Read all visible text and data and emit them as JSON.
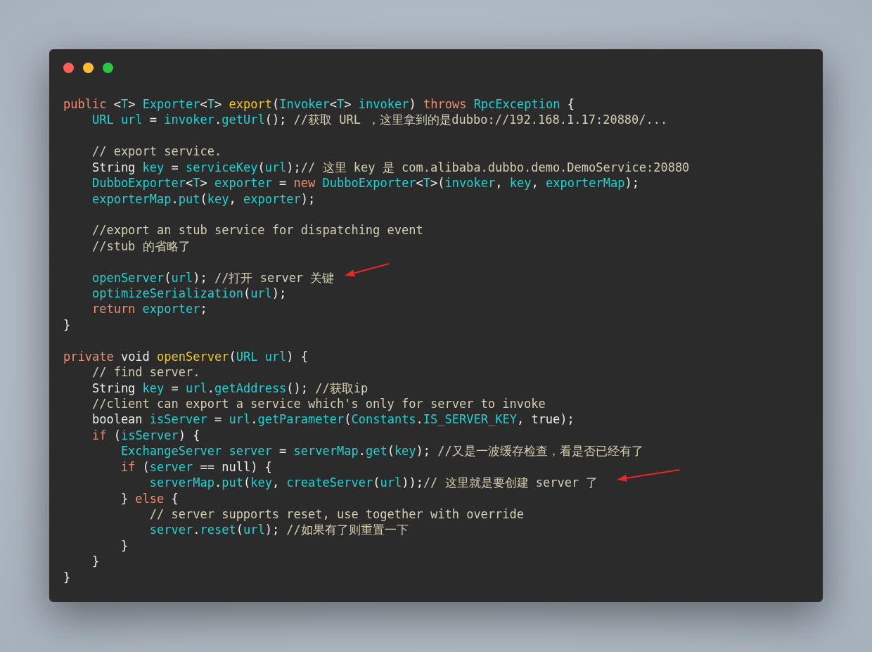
{
  "window": {
    "controls": [
      {
        "color": "#fe5f57"
      },
      {
        "color": "#febc2e"
      },
      {
        "color": "#28c840"
      }
    ]
  },
  "code_lines": [
    {
      "kind": "code",
      "tokens": [
        {
          "kind": "keyword",
          "text": "public "
        },
        {
          "kind": "plain",
          "text": "<"
        },
        {
          "kind": "ident",
          "text": "T"
        },
        {
          "kind": "plain",
          "text": "> "
        },
        {
          "kind": "ident",
          "text": "Exporter"
        },
        {
          "kind": "plain",
          "text": "<"
        },
        {
          "kind": "ident",
          "text": "T"
        },
        {
          "kind": "plain",
          "text": "> "
        },
        {
          "kind": "function",
          "text": "export"
        },
        {
          "kind": "plain",
          "text": "("
        },
        {
          "kind": "ident",
          "text": "Invoker"
        },
        {
          "kind": "plain",
          "text": "<"
        },
        {
          "kind": "ident",
          "text": "T"
        },
        {
          "kind": "plain",
          "text": "> "
        },
        {
          "kind": "ident",
          "text": "invoker"
        },
        {
          "kind": "plain",
          "text": ") "
        },
        {
          "kind": "keyword",
          "text": "throws "
        },
        {
          "kind": "ident",
          "text": "RpcException"
        },
        {
          "kind": "plain",
          "text": " {"
        }
      ]
    },
    {
      "kind": "code",
      "tokens": [
        {
          "kind": "ident",
          "text": "    URL url"
        },
        {
          "kind": "plain",
          "text": " = "
        },
        {
          "kind": "ident",
          "text": "invoker"
        },
        {
          "kind": "plain",
          "text": "."
        },
        {
          "kind": "ident",
          "text": "getUrl"
        },
        {
          "kind": "plain",
          "text": "(); "
        },
        {
          "kind": "comment",
          "text": "//获取 URL ，这里拿到的是dubbo://192.168.1.17:20880/..."
        }
      ]
    },
    {
      "kind": "blank"
    },
    {
      "kind": "code",
      "tokens": [
        {
          "kind": "comment",
          "text": "    // export service."
        }
      ]
    },
    {
      "kind": "code",
      "tokens": [
        {
          "kind": "plain",
          "text": "    String "
        },
        {
          "kind": "ident",
          "text": "key"
        },
        {
          "kind": "plain",
          "text": " = "
        },
        {
          "kind": "ident",
          "text": "serviceKey"
        },
        {
          "kind": "plain",
          "text": "("
        },
        {
          "kind": "ident",
          "text": "url"
        },
        {
          "kind": "plain",
          "text": ");"
        },
        {
          "kind": "comment",
          "text": "// 这里 key 是 com.alibaba.dubbo.demo.DemoService:20880"
        }
      ]
    },
    {
      "kind": "code",
      "tokens": [
        {
          "kind": "ident",
          "text": "    DubboExporter"
        },
        {
          "kind": "plain",
          "text": "<"
        },
        {
          "kind": "ident",
          "text": "T"
        },
        {
          "kind": "plain",
          "text": "> "
        },
        {
          "kind": "ident",
          "text": "exporter"
        },
        {
          "kind": "plain",
          "text": " = "
        },
        {
          "kind": "keyword",
          "text": "new "
        },
        {
          "kind": "ident",
          "text": "DubboExporter"
        },
        {
          "kind": "plain",
          "text": "<"
        },
        {
          "kind": "ident",
          "text": "T"
        },
        {
          "kind": "plain",
          "text": ">("
        },
        {
          "kind": "ident",
          "text": "invoker"
        },
        {
          "kind": "plain",
          "text": ", "
        },
        {
          "kind": "ident",
          "text": "key"
        },
        {
          "kind": "plain",
          "text": ", "
        },
        {
          "kind": "ident",
          "text": "exporterMap"
        },
        {
          "kind": "plain",
          "text": ");"
        }
      ]
    },
    {
      "kind": "code",
      "tokens": [
        {
          "kind": "ident",
          "text": "    exporterMap"
        },
        {
          "kind": "plain",
          "text": "."
        },
        {
          "kind": "ident",
          "text": "put"
        },
        {
          "kind": "plain",
          "text": "("
        },
        {
          "kind": "ident",
          "text": "key"
        },
        {
          "kind": "plain",
          "text": ", "
        },
        {
          "kind": "ident",
          "text": "exporter"
        },
        {
          "kind": "plain",
          "text": ");"
        }
      ]
    },
    {
      "kind": "blank"
    },
    {
      "kind": "code",
      "tokens": [
        {
          "kind": "comment",
          "text": "    //export an stub service for dispatching event"
        }
      ]
    },
    {
      "kind": "code",
      "tokens": [
        {
          "kind": "comment",
          "text": "    //stub 的省略了"
        }
      ]
    },
    {
      "kind": "blank"
    },
    {
      "kind": "code",
      "tokens": [
        {
          "kind": "ident",
          "text": "    openServer"
        },
        {
          "kind": "plain",
          "text": "("
        },
        {
          "kind": "ident",
          "text": "url"
        },
        {
          "kind": "plain",
          "text": "); "
        },
        {
          "kind": "comment",
          "text": "//打开 server 关键"
        }
      ]
    },
    {
      "kind": "code",
      "tokens": [
        {
          "kind": "ident",
          "text": "    optimizeSerialization"
        },
        {
          "kind": "plain",
          "text": "("
        },
        {
          "kind": "ident",
          "text": "url"
        },
        {
          "kind": "plain",
          "text": ");"
        }
      ]
    },
    {
      "kind": "code",
      "tokens": [
        {
          "kind": "keyword",
          "text": "    return "
        },
        {
          "kind": "ident",
          "text": "exporter"
        },
        {
          "kind": "plain",
          "text": ";"
        }
      ]
    },
    {
      "kind": "code",
      "tokens": [
        {
          "kind": "plain",
          "text": "}"
        }
      ]
    },
    {
      "kind": "blank"
    },
    {
      "kind": "code",
      "tokens": [
        {
          "kind": "keyword",
          "text": "private "
        },
        {
          "kind": "plain",
          "text": "void "
        },
        {
          "kind": "function",
          "text": "openServer"
        },
        {
          "kind": "plain",
          "text": "("
        },
        {
          "kind": "ident",
          "text": "URL url"
        },
        {
          "kind": "plain",
          "text": ") {"
        }
      ]
    },
    {
      "kind": "code",
      "tokens": [
        {
          "kind": "comment",
          "text": "    // find server."
        }
      ]
    },
    {
      "kind": "code",
      "tokens": [
        {
          "kind": "plain",
          "text": "    String "
        },
        {
          "kind": "ident",
          "text": "key"
        },
        {
          "kind": "plain",
          "text": " = "
        },
        {
          "kind": "ident",
          "text": "url"
        },
        {
          "kind": "plain",
          "text": "."
        },
        {
          "kind": "ident",
          "text": "getAddress"
        },
        {
          "kind": "plain",
          "text": "(); "
        },
        {
          "kind": "comment",
          "text": "//获取ip"
        }
      ]
    },
    {
      "kind": "code",
      "tokens": [
        {
          "kind": "comment",
          "text": "    //client can export a service which's only for server to invoke"
        }
      ]
    },
    {
      "kind": "code",
      "tokens": [
        {
          "kind": "plain",
          "text": "    boolean "
        },
        {
          "kind": "ident",
          "text": "isServer"
        },
        {
          "kind": "plain",
          "text": " = "
        },
        {
          "kind": "ident",
          "text": "url"
        },
        {
          "kind": "plain",
          "text": "."
        },
        {
          "kind": "ident",
          "text": "getParameter"
        },
        {
          "kind": "plain",
          "text": "("
        },
        {
          "kind": "ident",
          "text": "Constants"
        },
        {
          "kind": "plain",
          "text": "."
        },
        {
          "kind": "ident",
          "text": "IS_SERVER_KEY"
        },
        {
          "kind": "plain",
          "text": ", true);"
        }
      ]
    },
    {
      "kind": "code",
      "tokens": [
        {
          "kind": "keyword",
          "text": "    if "
        },
        {
          "kind": "plain",
          "text": "("
        },
        {
          "kind": "ident",
          "text": "isServer"
        },
        {
          "kind": "plain",
          "text": ") {"
        }
      ]
    },
    {
      "kind": "code",
      "tokens": [
        {
          "kind": "ident",
          "text": "        ExchangeServer server"
        },
        {
          "kind": "plain",
          "text": " = "
        },
        {
          "kind": "ident",
          "text": "serverMap"
        },
        {
          "kind": "plain",
          "text": "."
        },
        {
          "kind": "ident",
          "text": "get"
        },
        {
          "kind": "plain",
          "text": "("
        },
        {
          "kind": "ident",
          "text": "key"
        },
        {
          "kind": "plain",
          "text": "); "
        },
        {
          "kind": "comment",
          "text": "//又是一波缓存检查，看是否已经有了"
        }
      ]
    },
    {
      "kind": "code",
      "tokens": [
        {
          "kind": "keyword",
          "text": "        if "
        },
        {
          "kind": "plain",
          "text": "("
        },
        {
          "kind": "ident",
          "text": "server"
        },
        {
          "kind": "plain",
          "text": " == null) {"
        }
      ]
    },
    {
      "kind": "code",
      "tokens": [
        {
          "kind": "ident",
          "text": "            serverMap"
        },
        {
          "kind": "plain",
          "text": "."
        },
        {
          "kind": "ident",
          "text": "put"
        },
        {
          "kind": "plain",
          "text": "("
        },
        {
          "kind": "ident",
          "text": "key"
        },
        {
          "kind": "plain",
          "text": ", "
        },
        {
          "kind": "ident",
          "text": "createServer"
        },
        {
          "kind": "plain",
          "text": "("
        },
        {
          "kind": "ident",
          "text": "url"
        },
        {
          "kind": "plain",
          "text": "));"
        },
        {
          "kind": "comment",
          "text": "// 这里就是要创建 server 了"
        }
      ]
    },
    {
      "kind": "code",
      "tokens": [
        {
          "kind": "plain",
          "text": "        } "
        },
        {
          "kind": "keyword",
          "text": "else "
        },
        {
          "kind": "plain",
          "text": "{"
        }
      ]
    },
    {
      "kind": "code",
      "tokens": [
        {
          "kind": "comment",
          "text": "            // server supports reset, use together with override"
        }
      ]
    },
    {
      "kind": "code",
      "tokens": [
        {
          "kind": "ident",
          "text": "            server"
        },
        {
          "kind": "plain",
          "text": "."
        },
        {
          "kind": "ident",
          "text": "reset"
        },
        {
          "kind": "plain",
          "text": "("
        },
        {
          "kind": "ident",
          "text": "url"
        },
        {
          "kind": "plain",
          "text": "); "
        },
        {
          "kind": "comment",
          "text": "//如果有了则重置一下"
        }
      ]
    },
    {
      "kind": "code",
      "tokens": [
        {
          "kind": "plain",
          "text": "        }"
        }
      ]
    },
    {
      "kind": "code",
      "tokens": [
        {
          "kind": "plain",
          "text": "    }"
        }
      ]
    },
    {
      "kind": "code",
      "tokens": [
        {
          "kind": "plain",
          "text": "}"
        }
      ]
    }
  ]
}
